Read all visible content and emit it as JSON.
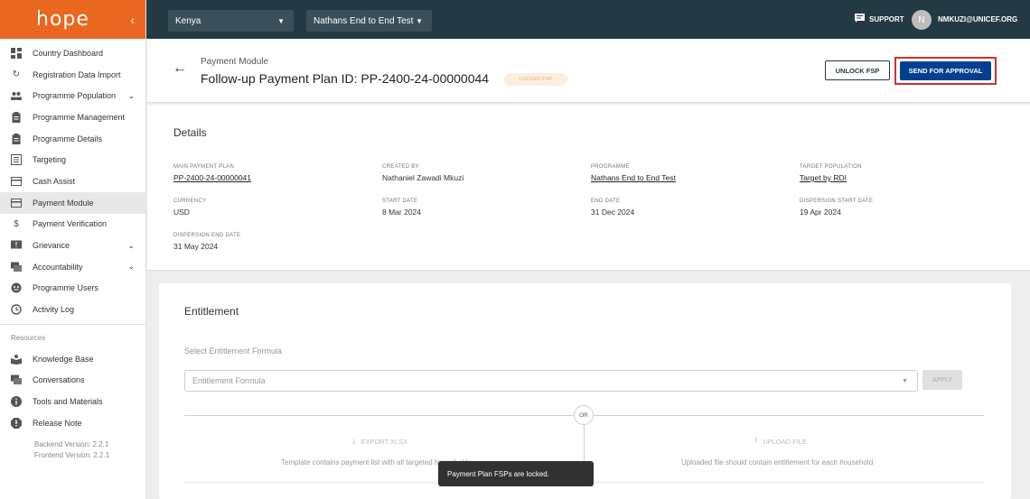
{
  "sidebar": {
    "logo": "hope",
    "items": [
      {
        "label": "Country Dashboard",
        "icon": "dashboard-icon"
      },
      {
        "label": "Registration Data Import",
        "icon": "sync-icon"
      },
      {
        "label": "Programme Population",
        "icon": "people-icon",
        "expandable": true
      },
      {
        "label": "Programme Management",
        "icon": "clipboard-icon"
      },
      {
        "label": "Programme Details",
        "icon": "clipboard-icon"
      },
      {
        "label": "Targeting",
        "icon": "list-icon"
      },
      {
        "label": "Cash Assist",
        "icon": "card-icon"
      },
      {
        "label": "Payment Module",
        "icon": "card-icon",
        "active": true
      },
      {
        "label": "Payment Verification",
        "icon": "dollar-icon"
      },
      {
        "label": "Grievance",
        "icon": "feedback-icon",
        "expandable": true
      },
      {
        "label": "Accountability",
        "icon": "forum-icon",
        "expandable": true
      },
      {
        "label": "Programme Users",
        "icon": "smile-icon"
      },
      {
        "label": "Activity Log",
        "icon": "history-icon"
      }
    ],
    "resources_label": "Resources",
    "resources": [
      {
        "label": "Knowledge Base",
        "icon": "book-icon"
      },
      {
        "label": "Conversations",
        "icon": "forum-icon"
      },
      {
        "label": "Tools and Materials",
        "icon": "info-icon"
      },
      {
        "label": "Release Note",
        "icon": "alert-icon"
      }
    ],
    "backend_version": "Backend Version: 2.2.1",
    "frontend_version": "Frontend Version: 2.2.1"
  },
  "topbar": {
    "country": "Kenya",
    "programme": "Nathans End to End Test",
    "support": "SUPPORT",
    "avatar_initial": "N",
    "user": "NMKUZI@UNICEF.ORG"
  },
  "header": {
    "breadcrumb": "Payment Module",
    "title": "Follow-up Payment Plan ID: PP-2400-24-00000044",
    "status_badge": "LOCKED FSP",
    "unlock_label": "UNLOCK FSP",
    "send_label": "SEND FOR APPROVAL"
  },
  "details": {
    "title": "Details",
    "main_payment_plan_label": "MAIN PAYMENT PLAN",
    "main_payment_plan": "PP-2400-24-00000041",
    "created_by_label": "CREATED BY",
    "created_by": "Nathaniel Zawadi Mkuzi",
    "programme_label": "PROGRAMME",
    "programme": "Nathans End to End Test",
    "target_population_label": "TARGET POPULATION",
    "target_population": "Target by RDI",
    "currency_label": "CURRENCY",
    "currency": "USD",
    "start_date_label": "START DATE",
    "start_date": "8 Mar 2024",
    "end_date_label": "END DATE",
    "end_date": "31 Dec 2024",
    "dispersion_start_label": "DISPERSION START DATE",
    "dispersion_start": "19 Apr 2024",
    "dispersion_end_label": "DISPERSION END DATE",
    "dispersion_end": "31 May 2024"
  },
  "entitlement": {
    "title": "Entitlement",
    "select_label": "Select Entitlement Formula",
    "select_placeholder": "Entitlement Formula",
    "apply_label": "APPLY",
    "or_label": "OR",
    "export_label": "EXPORT XLSX",
    "export_desc": "Template contains payment list with all targeted households",
    "upload_label": "UPLOAD FILE",
    "upload_desc": "Uploaded file should contain entitlement for each household"
  },
  "snackbar": "Payment Plan FSPs are locked.",
  "colors": {
    "brand_orange": "#e9671f",
    "topbar": "#233944",
    "primary": "#033f91",
    "highlight": "#d32f2f"
  }
}
